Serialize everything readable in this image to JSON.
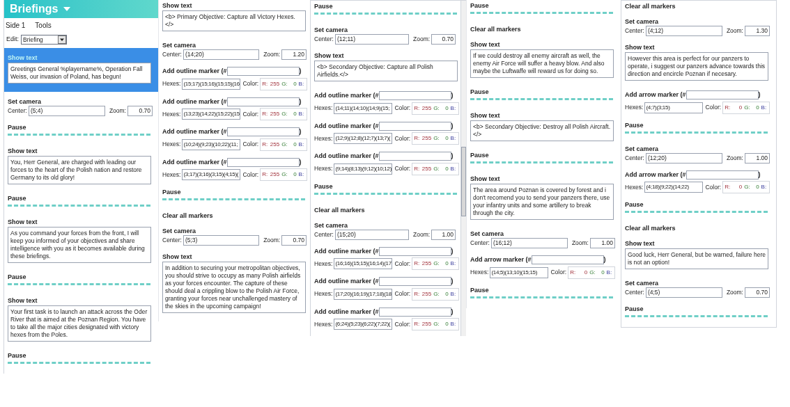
{
  "header": {
    "title": "Briefings",
    "menu": [
      "Side 1",
      "Tools"
    ],
    "edit_label": "Edit:",
    "edit_value": "Briefing"
  },
  "columns": [
    {
      "items": [
        {
          "kind": "show_text",
          "selected": true,
          "label": "Show text",
          "text": "Greetings General %playername%, Operation Fall Weiss, our invasion of Poland, has begun!"
        },
        {
          "kind": "set_camera",
          "selected": false,
          "label": "Set camera",
          "center_label": "Center:",
          "center": "(5;4)",
          "zoom_label": "Zoom:",
          "zoom": "0.70"
        },
        {
          "kind": "pause",
          "selected": false,
          "label": "Pause"
        },
        {
          "kind": "show_text",
          "selected": false,
          "label": "Show text",
          "text": "You, Herr General, are charged with leading our forces to the heart of the Polish nation and restore Germany to its old glory!"
        },
        {
          "kind": "pause",
          "selected": false,
          "label": "Pause"
        },
        {
          "kind": "show_text",
          "selected": false,
          "label": "Show text",
          "text": "As you command your forces from the front, I will keep you informed of your objectives and share intelligence with you as it becomes available during these briefings."
        },
        {
          "kind": "pause",
          "selected": false,
          "label": "Pause"
        },
        {
          "kind": "show_text",
          "selected": false,
          "label": "Show text",
          "text": "Your first task is to launch an attack across the Oder River that is aimed at the Poznan Region. You have to take all the major cities designated with victory hexes from the Poles."
        },
        {
          "kind": "pause",
          "selected": false,
          "label": "Pause"
        }
      ]
    },
    {
      "items": [
        {
          "kind": "show_text",
          "label": "Show text",
          "text": "<b> Primary Objective: Capture all Victory Hexes.</>"
        },
        {
          "kind": "set_camera",
          "label": "Set camera",
          "center_label": "Center:",
          "center": "(14;20)",
          "zoom_label": "Zoom:",
          "zoom": "1.20"
        },
        {
          "kind": "marker",
          "label": "Add outline marker (#",
          "close": ")",
          "hexes_label": "Hexes:",
          "hexes": "(15;17)(15;16)(15;15)(16",
          "color_label": "Color:",
          "r_label": "R:",
          "r": "255",
          "g_label": "G:",
          "g": "0",
          "b_label": "B:"
        },
        {
          "kind": "marker",
          "label": "Add outline marker (#",
          "close": ")",
          "hexes_label": "Hexes:",
          "hexes": "(13;23)(14;22)(15;22)(15",
          "color_label": "Color:",
          "r_label": "R:",
          "r": "255",
          "g_label": "G:",
          "g": "0",
          "b_label": "B:"
        },
        {
          "kind": "marker",
          "label": "Add outline marker (#",
          "close": ")",
          "hexes_label": "Hexes:",
          "hexes": "(10;24)(9;23)(10;22)(11;",
          "color_label": "Color:",
          "r_label": "R:",
          "r": "255",
          "g_label": "G:",
          "g": "0",
          "b_label": "B:"
        },
        {
          "kind": "marker",
          "label": "Add outline marker (#",
          "close": ")",
          "hexes_label": "Hexes:",
          "hexes": "(3;17)(3;16)(3;15)(4;15)(",
          "color_label": "Color:",
          "r_label": "R:",
          "r": "255",
          "g_label": "G:",
          "g": "0",
          "b_label": "B:"
        },
        {
          "kind": "pause",
          "label": "Pause"
        },
        {
          "kind": "clear",
          "label": "Clear all markers"
        },
        {
          "kind": "set_camera",
          "label": "Set camera",
          "center_label": "Center:",
          "center": "(5;3)",
          "zoom_label": "Zoom:",
          "zoom": "0.70"
        },
        {
          "kind": "show_text",
          "label": "Show text",
          "text": "In addition to securing your metropolitan objectives, you should strive to occupy as many Polish airfields as your forces encounter.  The capture of these should deal a crippling blow to the Polish Air Force, granting your forces near unchallenged mastery of the skies in the upcoming campaign!"
        }
      ]
    },
    {
      "scrollbar": true,
      "items": [
        {
          "kind": "pause",
          "label": "Pause"
        },
        {
          "kind": "set_camera",
          "label": "Set camera",
          "center_label": "Center:",
          "center": "(12;11)",
          "zoom_label": "Zoom:",
          "zoom": "0.70"
        },
        {
          "kind": "show_text",
          "label": "Show text",
          "text": "<b> Secondary Objective: Capture all Polish Airfields.</>"
        },
        {
          "kind": "marker",
          "label": "Add outline marker (#",
          "close": ")",
          "hexes_label": "Hexes:",
          "hexes": "(14;11)(14;10)(14;9)(15;",
          "color_label": "Color:",
          "r_label": "R:",
          "r": "255",
          "g_label": "G:",
          "g": "0",
          "b_label": "B:"
        },
        {
          "kind": "marker",
          "label": "Add outline marker (#",
          "close": ")",
          "hexes_label": "Hexes:",
          "hexes": "(12;9)(12;8)(12;7)(13;7)(",
          "color_label": "Color:",
          "r_label": "R:",
          "r": "255",
          "g_label": "G:",
          "g": "0",
          "b_label": "B:"
        },
        {
          "kind": "marker",
          "label": "Add outline marker (#",
          "close": ")",
          "hexes_label": "Hexes:",
          "hexes": "(9;14)(8;13)(9;12)(10;12)",
          "color_label": "Color:",
          "r_label": "R:",
          "r": "255",
          "g_label": "G:",
          "g": "0",
          "b_label": "B:"
        },
        {
          "kind": "pause",
          "label": "Pause"
        },
        {
          "kind": "clear",
          "label": "Clear all markers"
        },
        {
          "kind": "set_camera",
          "label": "Set camera",
          "center_label": "Center:",
          "center": "(15;20)",
          "zoom_label": "Zoom:",
          "zoom": "1.00"
        },
        {
          "kind": "marker",
          "label": "Add outline marker (#",
          "close": ")",
          "hexes_label": "Hexes:",
          "hexes": "(16;16)(15;15)(16;14)(17",
          "color_label": "Color:",
          "r_label": "R:",
          "r": "255",
          "g_label": "G:",
          "g": "0",
          "b_label": "B:"
        },
        {
          "kind": "marker",
          "label": "Add outline marker (#",
          "close": ")",
          "hexes_label": "Hexes:",
          "hexes": "(17;20)(16;19)(17;18)(18",
          "color_label": "Color:",
          "r_label": "R:",
          "r": "255",
          "g_label": "G:",
          "g": "0",
          "b_label": "B:"
        },
        {
          "kind": "marker",
          "label": "Add outline marker (#",
          "close": ")",
          "hexes_label": "Hexes:",
          "hexes": "(6;24)(5;23)(6;22)(7;22)(",
          "color_label": "Color:",
          "r_label": "R:",
          "r": "255",
          "g_label": "G:",
          "g": "0",
          "b_label": "B:"
        }
      ]
    },
    {
      "items": [
        {
          "kind": "pause",
          "label": "Pause"
        },
        {
          "kind": "clear",
          "label": "Clear all markers"
        },
        {
          "kind": "show_text",
          "label": "Show text",
          "text": "If we could destroy all enemy aircraft as well, the enemy Air Force will suffer a heavy blow. And also maybe the Luftwaffe will reward us for doing so."
        },
        {
          "kind": "pause",
          "label": "Pause"
        },
        {
          "kind": "show_text",
          "label": "Show text",
          "text": "<b> Secondary Objective: Destroy all Polish Aircraft.</>"
        },
        {
          "kind": "pause",
          "label": "Pause"
        },
        {
          "kind": "show_text",
          "label": "Show text",
          "text": "The area around Poznan is covered by forest and i don't recomend you to send your panzers there, use your infantry units and some artillery to break through the city."
        },
        {
          "kind": "set_camera",
          "label": "Set camera",
          "center_label": "Center:",
          "center": "(16;12)",
          "zoom_label": "Zoom:",
          "zoom": "1.00"
        },
        {
          "kind": "marker",
          "label": "Add arrow marker (#",
          "close": ")",
          "hexes_label": "Hexes:",
          "hexes": "(14;5)(13;10)(15;15)",
          "color_label": "Color:",
          "r_label": "R:",
          "r": "0",
          "g_label": "G:",
          "g": "0",
          "b_label": "B:"
        },
        {
          "kind": "pause",
          "label": "Pause"
        }
      ]
    },
    {
      "items": [
        {
          "kind": "clear",
          "label": "Clear all markers"
        },
        {
          "kind": "set_camera",
          "label": "Set camera",
          "center_label": "Center:",
          "center": "(4;12)",
          "zoom_label": "Zoom:",
          "zoom": "1.30"
        },
        {
          "kind": "show_text",
          "label": "Show text",
          "text": "However this area is perfect for our panzers to operate, i suggest our panzers advance towards this direction and encircle Poznan if necesary."
        },
        {
          "kind": "marker",
          "label": "Add arrow marker (#",
          "close": ")",
          "hexes_label": "Hexes:",
          "hexes": "(4;7)(3;15)",
          "color_label": "Color:",
          "r_label": "R:",
          "r": "0",
          "g_label": "G:",
          "g": "0",
          "b_label": "B:"
        },
        {
          "kind": "pause",
          "label": "Pause"
        },
        {
          "kind": "set_camera",
          "label": "Set camera",
          "center_label": "Center:",
          "center": "(12;20)",
          "zoom_label": "Zoom:",
          "zoom": "1.00"
        },
        {
          "kind": "marker",
          "label": "Add arrow marker (#",
          "close": ")",
          "hexes_label": "Hexes:",
          "hexes": "(4;18)(9;22)(14;22)",
          "color_label": "Color:",
          "r_label": "R:",
          "r": "0",
          "g_label": "G:",
          "g": "0",
          "b_label": "B:"
        },
        {
          "kind": "pause",
          "label": "Pause"
        },
        {
          "kind": "clear",
          "label": "Clear all markers"
        },
        {
          "kind": "show_text",
          "label": "Show text",
          "text": "Good luck, Herr General, but be warned, failure here is not an option!"
        },
        {
          "kind": "set_camera",
          "label": "Set camera",
          "center_label": "Center:",
          "center": "(4;5)",
          "zoom_label": "Zoom:",
          "zoom": "0.70"
        },
        {
          "kind": "pause",
          "label": "Pause"
        }
      ]
    }
  ]
}
